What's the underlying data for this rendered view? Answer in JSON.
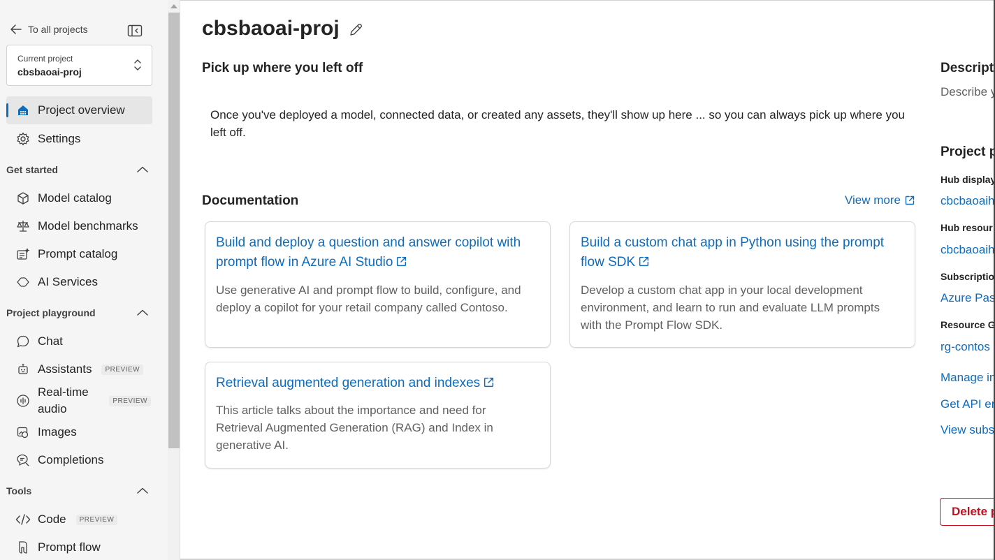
{
  "sidebar": {
    "back_label": "To all projects",
    "project_picker": {
      "label": "Current project",
      "value": "cbsbaoai-proj"
    },
    "top_items": [
      {
        "label": "Project overview",
        "icon": "home-icon",
        "active": true
      },
      {
        "label": "Settings",
        "icon": "gear-icon"
      }
    ],
    "sections": [
      {
        "title": "Get started",
        "items": [
          {
            "label": "Model catalog",
            "icon": "cube-icon"
          },
          {
            "label": "Model benchmarks",
            "icon": "scale-icon"
          },
          {
            "label": "Prompt catalog",
            "icon": "prompt-sparkle-icon"
          },
          {
            "label": "AI Services",
            "icon": "ai-services-icon"
          }
        ]
      },
      {
        "title": "Project playground",
        "items": [
          {
            "label": "Chat",
            "icon": "chat-icon"
          },
          {
            "label": "Assistants",
            "icon": "bot-icon",
            "badge": "PREVIEW"
          },
          {
            "label": "Real-time audio",
            "icon": "audio-icon",
            "badge": "PREVIEW"
          },
          {
            "label": "Images",
            "icon": "image-icon"
          },
          {
            "label": "Completions",
            "icon": "completions-icon"
          }
        ]
      },
      {
        "title": "Tools",
        "items": [
          {
            "label": "Code",
            "icon": "code-icon",
            "badge": "PREVIEW"
          },
          {
            "label": "Prompt flow",
            "icon": "prompt-flow-icon"
          }
        ]
      }
    ]
  },
  "main": {
    "title": "cbsbaoai-proj",
    "pickup": {
      "heading": "Pick up where you left off",
      "message": "Once you've deployed a model, connected data, or created any assets, they'll show up here ... so you can always pick up where you left off."
    },
    "documentation": {
      "heading": "Documentation",
      "view_more": "View more",
      "cards": [
        {
          "title": "Build and deploy a question and answer copilot with prompt flow in Azure AI Studio",
          "description": "Use generative AI and prompt flow to build, configure, and deploy a copilot for your retail company called Contoso."
        },
        {
          "title": "Build a custom chat app in Python using the prompt flow SDK",
          "description": "Develop a custom chat app in your local development environment, and learn to run and evaluate LLM prompts with the Prompt Flow SDK."
        },
        {
          "title": "Retrieval augmented generation and indexes",
          "description": "This article talks about the importance and need for Retrieval Augmented Generation (RAG) and Index in generative AI."
        }
      ]
    }
  },
  "right_panel": {
    "description_heading": "Descripti",
    "description_placeholder": "Describe y",
    "properties_heading": "Project p",
    "properties": [
      {
        "label": "Hub display",
        "value": "cbcbaoaih"
      },
      {
        "label": "Hub resour",
        "value": "cbcbaoaih"
      },
      {
        "label": "Subscriptio",
        "value": "Azure Pass"
      },
      {
        "label": "Resource G",
        "value": "rg-contos"
      }
    ],
    "links": [
      "Manage in",
      "Get API en",
      "View subs"
    ],
    "delete_label": "Delete p"
  },
  "colors": {
    "accent": "#0f6cbd",
    "danger": "#c50f1f",
    "sidebar_bg": "#f5f5f5"
  }
}
